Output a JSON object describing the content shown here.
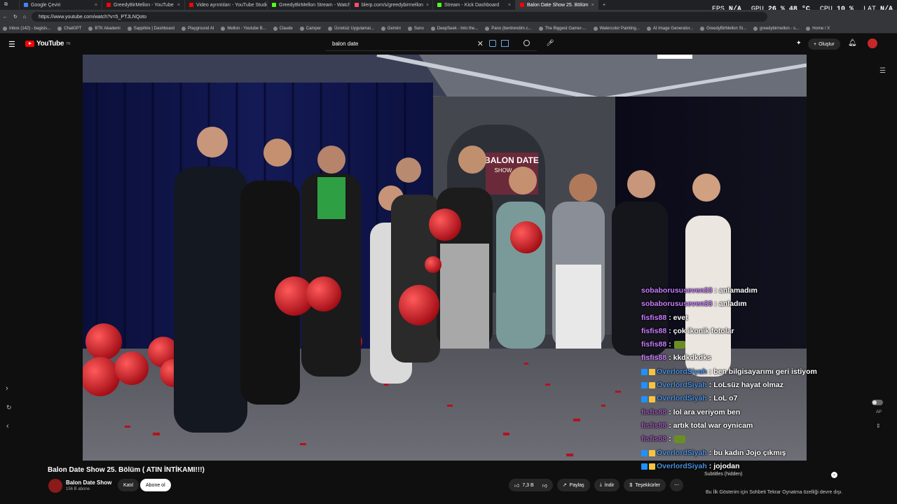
{
  "tabs": [
    {
      "label": "Google Çeviri",
      "color": "#4285f4"
    },
    {
      "label": "GreedyBirMellon - YouTube",
      "color": "#ff0000"
    },
    {
      "label": "Video ayrıntıları - YouTube Studio",
      "color": "#ff0000"
    },
    {
      "label": "GreedyBirMellon Stream - Watch",
      "color": "#53fc18"
    },
    {
      "label": "blerp.com/s/greedybirmellon",
      "color": "#ff4d6d"
    },
    {
      "label": "Stream - Kick Dashboard",
      "color": "#53fc18"
    },
    {
      "label": "Balon Date Show 25. Bölüm",
      "color": "#ff0000"
    }
  ],
  "stats": {
    "fps_label": "FPS",
    "fps": "N/A",
    "gpu_label": "GPU",
    "gpu": "26 %  48 °C",
    "cpu_label": "CPU",
    "cpu": "10 %",
    "lat_label": "LAT",
    "lat": "N/A"
  },
  "url": "https://www.youtube.com/watch?v=5_PTJLNQoto",
  "bookmarks": [
    "Inbox (142) - bagisis...",
    "ChatGPT",
    "BTK Akademi",
    "Sapphire | Dashboard",
    "Playground AI",
    "Mellon - Youtube B...",
    "Claude",
    "Camper",
    "Ücretsiz Uygulamal...",
    "Gemini",
    "Suno",
    "DeepSeek - Into the...",
    "Pano (bentrendim.c...",
    "The Biggest Gamer-...",
    "Watercolor Painting...",
    "AI Image Generator...",
    "GreedyBirMellon St...",
    "greedybirmellon - s...",
    "Home / X"
  ],
  "youtube": {
    "logo_text": "YouTube",
    "logo_region": "TR",
    "search_query": "balon date",
    "create_label": "Oluştur"
  },
  "video": {
    "title": "Balon Date Show 25. Bölüm ( ATIN İNTİKAMI!!!)",
    "sign_text_1": "BALON DATE",
    "sign_text_2": "SHOW",
    "channel_name": "Balon Date Show",
    "subscribers": "156 B abone",
    "join_label": "Katıl",
    "subscribe_label": "Abone ol",
    "likes": "7,3 B",
    "share_label": "Paylaş",
    "download_label": "İndir",
    "thanks_label": "Teşekkürler"
  },
  "chat": [
    {
      "user": "sobaborususeven33",
      "msg": ": anlamadım",
      "style": "u-p",
      "badge": false,
      "emote": false
    },
    {
      "user": "sobaborususeven33",
      "msg": ": anladım",
      "style": "u-p",
      "badge": false,
      "emote": false
    },
    {
      "user": "fisfis88",
      "msg": ": evet",
      "style": "u-p",
      "badge": false,
      "emote": false
    },
    {
      "user": "fisfis88",
      "msg": ": çok ikonik fotolar",
      "style": "u-p",
      "badge": false,
      "emote": false
    },
    {
      "user": "fisfis88",
      "msg": ":",
      "style": "u-p",
      "badge": false,
      "emote": true
    },
    {
      "user": "fisfis88",
      "msg": ": kkdkdkdks",
      "style": "u-p",
      "badge": false,
      "emote": false
    },
    {
      "user": "OverlordSiyah",
      "msg": ": ben bilgisayarımı geri istiyom",
      "style": "u-b",
      "badge": true,
      "emote": false
    },
    {
      "user": "OverlordSiyah",
      "msg": ": LoLsüz hayat olmaz",
      "style": "u-b",
      "badge": true,
      "emote": false
    },
    {
      "user": "OverlordSiyah",
      "msg": ": LoL o7",
      "style": "u-b",
      "badge": true,
      "emote": false
    },
    {
      "user": "fisfis88",
      "msg": ": lol ara veriyom ben",
      "style": "u-f",
      "badge": false,
      "emote": false
    },
    {
      "user": "fisfis88",
      "msg": ": artık total war oynicam",
      "style": "u-f",
      "badge": false,
      "emote": false
    },
    {
      "user": "fisfis88",
      "msg": ":",
      "style": "u-f",
      "badge": false,
      "emote": true
    },
    {
      "user": "OverlordSiyah",
      "msg": ": bu kadın Jojo çıkmış",
      "style": "u-b",
      "badge": true,
      "emote": false
    },
    {
      "user": "OverlordSiyah",
      "msg": ": jojodan",
      "style": "u-b",
      "badge": true,
      "emote": false
    }
  ],
  "chat_panel": {
    "subtitles": "Subtitles (hidden)",
    "replay_text": "Bu İlk Gösterim için Sohbeti Tekrar Oynatma özelliği devre dışı."
  },
  "ap_label": "AP"
}
